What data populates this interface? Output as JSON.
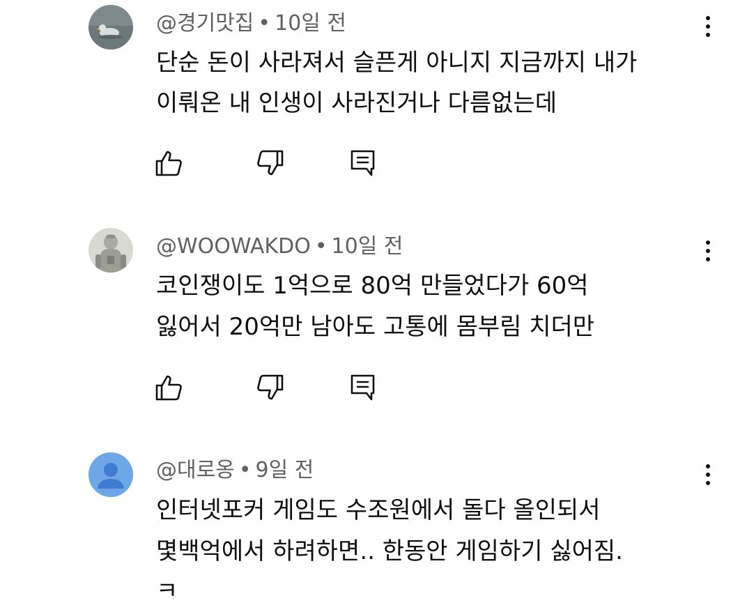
{
  "comments": [
    {
      "author": "@경기맛집",
      "separator": "•",
      "time": "10일 전",
      "lines": [
        "단순 돈이 사라져서 슬픈게 아니지 지금까지 내가",
        "이뤄온 내 인생이 사라진거나 다름없는데"
      ],
      "avatar_icon": "duck-on-water-photo-avatar"
    },
    {
      "author": "@WOOWAKDO",
      "separator": "•",
      "time": "10일 전",
      "lines": [
        "코인쟁이도 1억으로 80억 만들었다가 60억",
        "잃어서 20억만 남아도 고통에 몸부림 치더만"
      ],
      "avatar_icon": "robot-figure-photo-avatar"
    },
    {
      "author": "@대로옹",
      "separator": "•",
      "time": "9일 전",
      "lines": [
        "인터넷포커 게임도 수조원에서 돌다 올인되서",
        "몇백억에서 하려하면.. 한동안 게임하기 싫어짐.",
        "ㅋ"
      ],
      "avatar_icon": "default-person-avatar",
      "avatar_color": "#6ea7e8"
    }
  ],
  "icons": {
    "like": "thumbs-up-icon",
    "dislike": "thumbs-down-icon",
    "reply": "reply-comment-icon",
    "more": "more-vert-icon"
  }
}
